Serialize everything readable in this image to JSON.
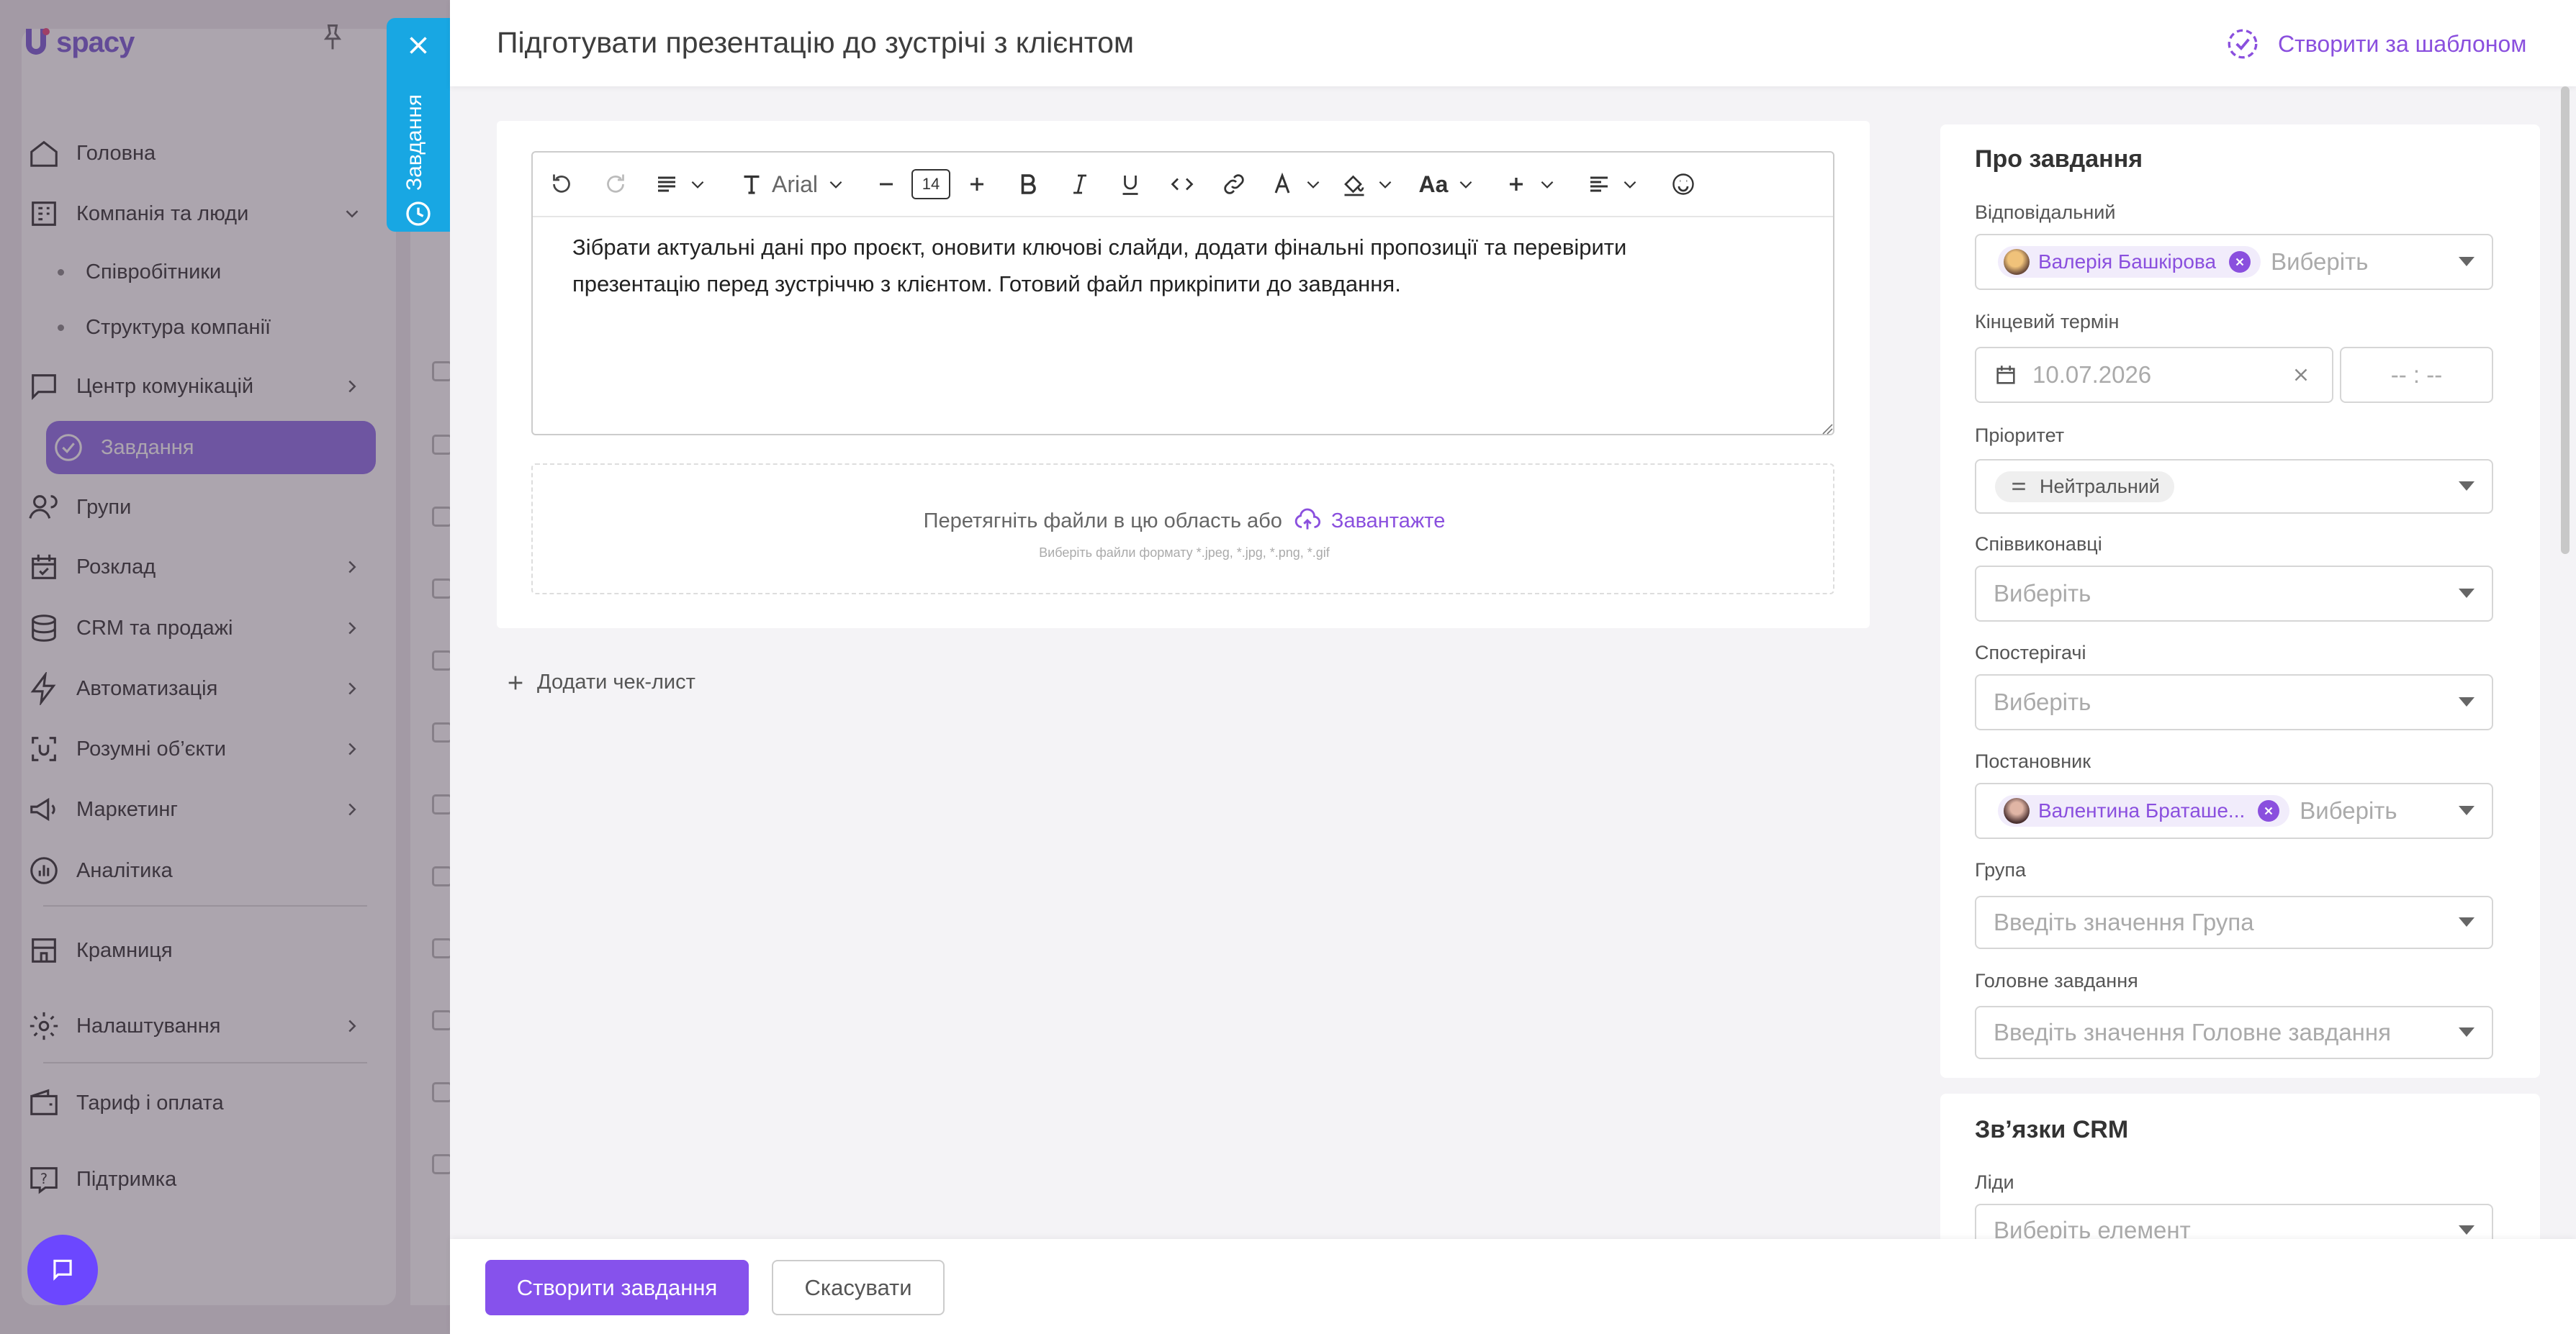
{
  "sidebar": {
    "logo_text": "spacy",
    "items": [
      {
        "label": "Головна",
        "icon": "home-icon"
      },
      {
        "label": "Компанія та люди",
        "icon": "company-icon"
      },
      {
        "label": "Співробітники"
      },
      {
        "label": "Структура компанії"
      },
      {
        "label": "Центр комунікацій",
        "icon": "chat-icon"
      },
      {
        "label": "Завдання",
        "icon": "tasks-icon"
      },
      {
        "label": "Групи",
        "icon": "groups-icon"
      },
      {
        "label": "Розклад",
        "icon": "calendar-icon"
      },
      {
        "label": "CRM та продажі",
        "icon": "crm-icon"
      },
      {
        "label": "Автоматизація",
        "icon": "bolt-icon"
      },
      {
        "label": "Розумні об’єкти",
        "icon": "smart-objects-icon"
      },
      {
        "label": "Маркетинг",
        "icon": "marketing-icon"
      },
      {
        "label": "Аналітика",
        "icon": "analytics-icon"
      },
      {
        "label": "Крамниця",
        "icon": "store-icon"
      },
      {
        "label": "Налаштування",
        "icon": "gear-icon"
      },
      {
        "label": "Тариф і оплата",
        "icon": "wallet-icon"
      },
      {
        "label": "Підтримка",
        "icon": "help-icon"
      }
    ]
  },
  "side_tab": {
    "label": "Завдання"
  },
  "header": {
    "title": "Підготувати презентацію до зустрічі з клієнтом",
    "template_button": "Створити за шаблоном"
  },
  "editor": {
    "font": "Arial",
    "font_size": "14",
    "case_label": "Aa",
    "body_line1": "Зібрати актуальні дані про проєкт, оновити ключові слайди, додати фінальні пропозиції та перевірити",
    "body_line2": "презентацію перед зустріччю з клієнтом. Готовий файл прикріпити до завдання."
  },
  "dropzone": {
    "text": "Перетягніть файли в цю область або",
    "upload_link": "Завантажте",
    "hint": "Виберіть файли формату *.jpeg, *.jpg, *.png, *.gif"
  },
  "checklist": {
    "add_label": "Додати чек-лист"
  },
  "about": {
    "title": "Про завдання",
    "responsible_label": "Відповідальний",
    "responsible_chip": "Валерія Башкірова",
    "responsible_placeholder": "Виберіть",
    "deadline_label": "Кінцевий термін",
    "deadline_date": "10.07.2026",
    "deadline_time": "-- : --",
    "priority_label": "Пріоритет",
    "priority_value": "Нейтральний",
    "coexecutors_label": "Співвиконавці",
    "coexecutors_placeholder": "Виберіть",
    "observers_label": "Спостерігачі",
    "observers_placeholder": "Виберіть",
    "creator_label": "Постановник",
    "creator_chip": "Валентина Браташе...",
    "creator_placeholder": "Виберіть",
    "group_label": "Група",
    "group_placeholder": "Введіть значення Група",
    "parent_label": "Головне завдання",
    "parent_placeholder": "Введіть значення Головне завдання"
  },
  "crm": {
    "title": "Зв’язки CRM",
    "leads_label": "Ліди",
    "leads_placeholder": "Виберіть елемент"
  },
  "footer": {
    "create_label": "Створити завдання",
    "cancel_label": "Скасувати"
  },
  "colors": {
    "accent": "#8652ec",
    "tab": "#18a7e3",
    "link": "#8a4fde"
  }
}
